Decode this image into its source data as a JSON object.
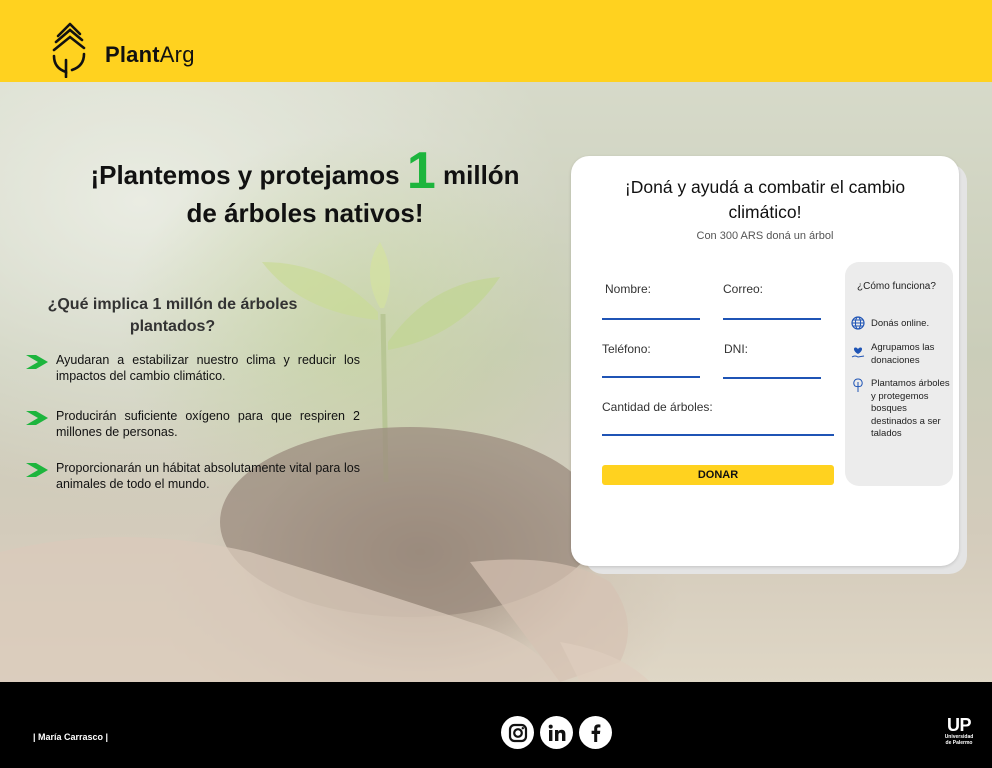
{
  "brand": {
    "name_bold": "Plant",
    "name_rest": "Arg"
  },
  "hero": {
    "title_part1": "¡Plantemos y protejamos ",
    "title_number": "1",
    "title_part2": " millón",
    "title_line2": "de árboles nativos!",
    "question": "¿Qué implica 1 millón de árboles plantados?",
    "bullets": [
      "Ayudaran a estabilizar nuestro clima y reducir los impactos del cambio climático.",
      "Producirán suficiente oxígeno para que respiren 2 millones de personas.",
      "Proporcionarán un hábitat absolutamente vital para los animales de todo el mundo."
    ]
  },
  "form": {
    "title": "¡Doná y ayudá a combatir el cambio climático!",
    "subtitle": "Con 300 ARS doná un árbol",
    "fields": {
      "name": "Nombre:",
      "email": "Correo:",
      "phone": "Teléfono:",
      "dni": "DNI:",
      "trees": "Cantidad de árboles:"
    },
    "donate_label": "DONAR"
  },
  "how": {
    "title": "¿Cómo funciona?",
    "steps": [
      {
        "icon": "globe-icon",
        "text": "Donás online."
      },
      {
        "icon": "heart-hand-icon",
        "text": "Agrupamos las donaciones"
      },
      {
        "icon": "tree-icon",
        "text": "Plantamos árboles y protegemos bosques destinados a ser talados"
      }
    ]
  },
  "footer": {
    "author": "| María Carrasco |",
    "social": [
      "instagram-icon",
      "linkedin-icon",
      "facebook-icon"
    ],
    "university_short": "UP",
    "university_line1": "Universidad",
    "university_line2": "de Palermo"
  },
  "colors": {
    "yellow": "#ffd21f",
    "green": "#1db53d",
    "blue": "#1f54b5"
  }
}
